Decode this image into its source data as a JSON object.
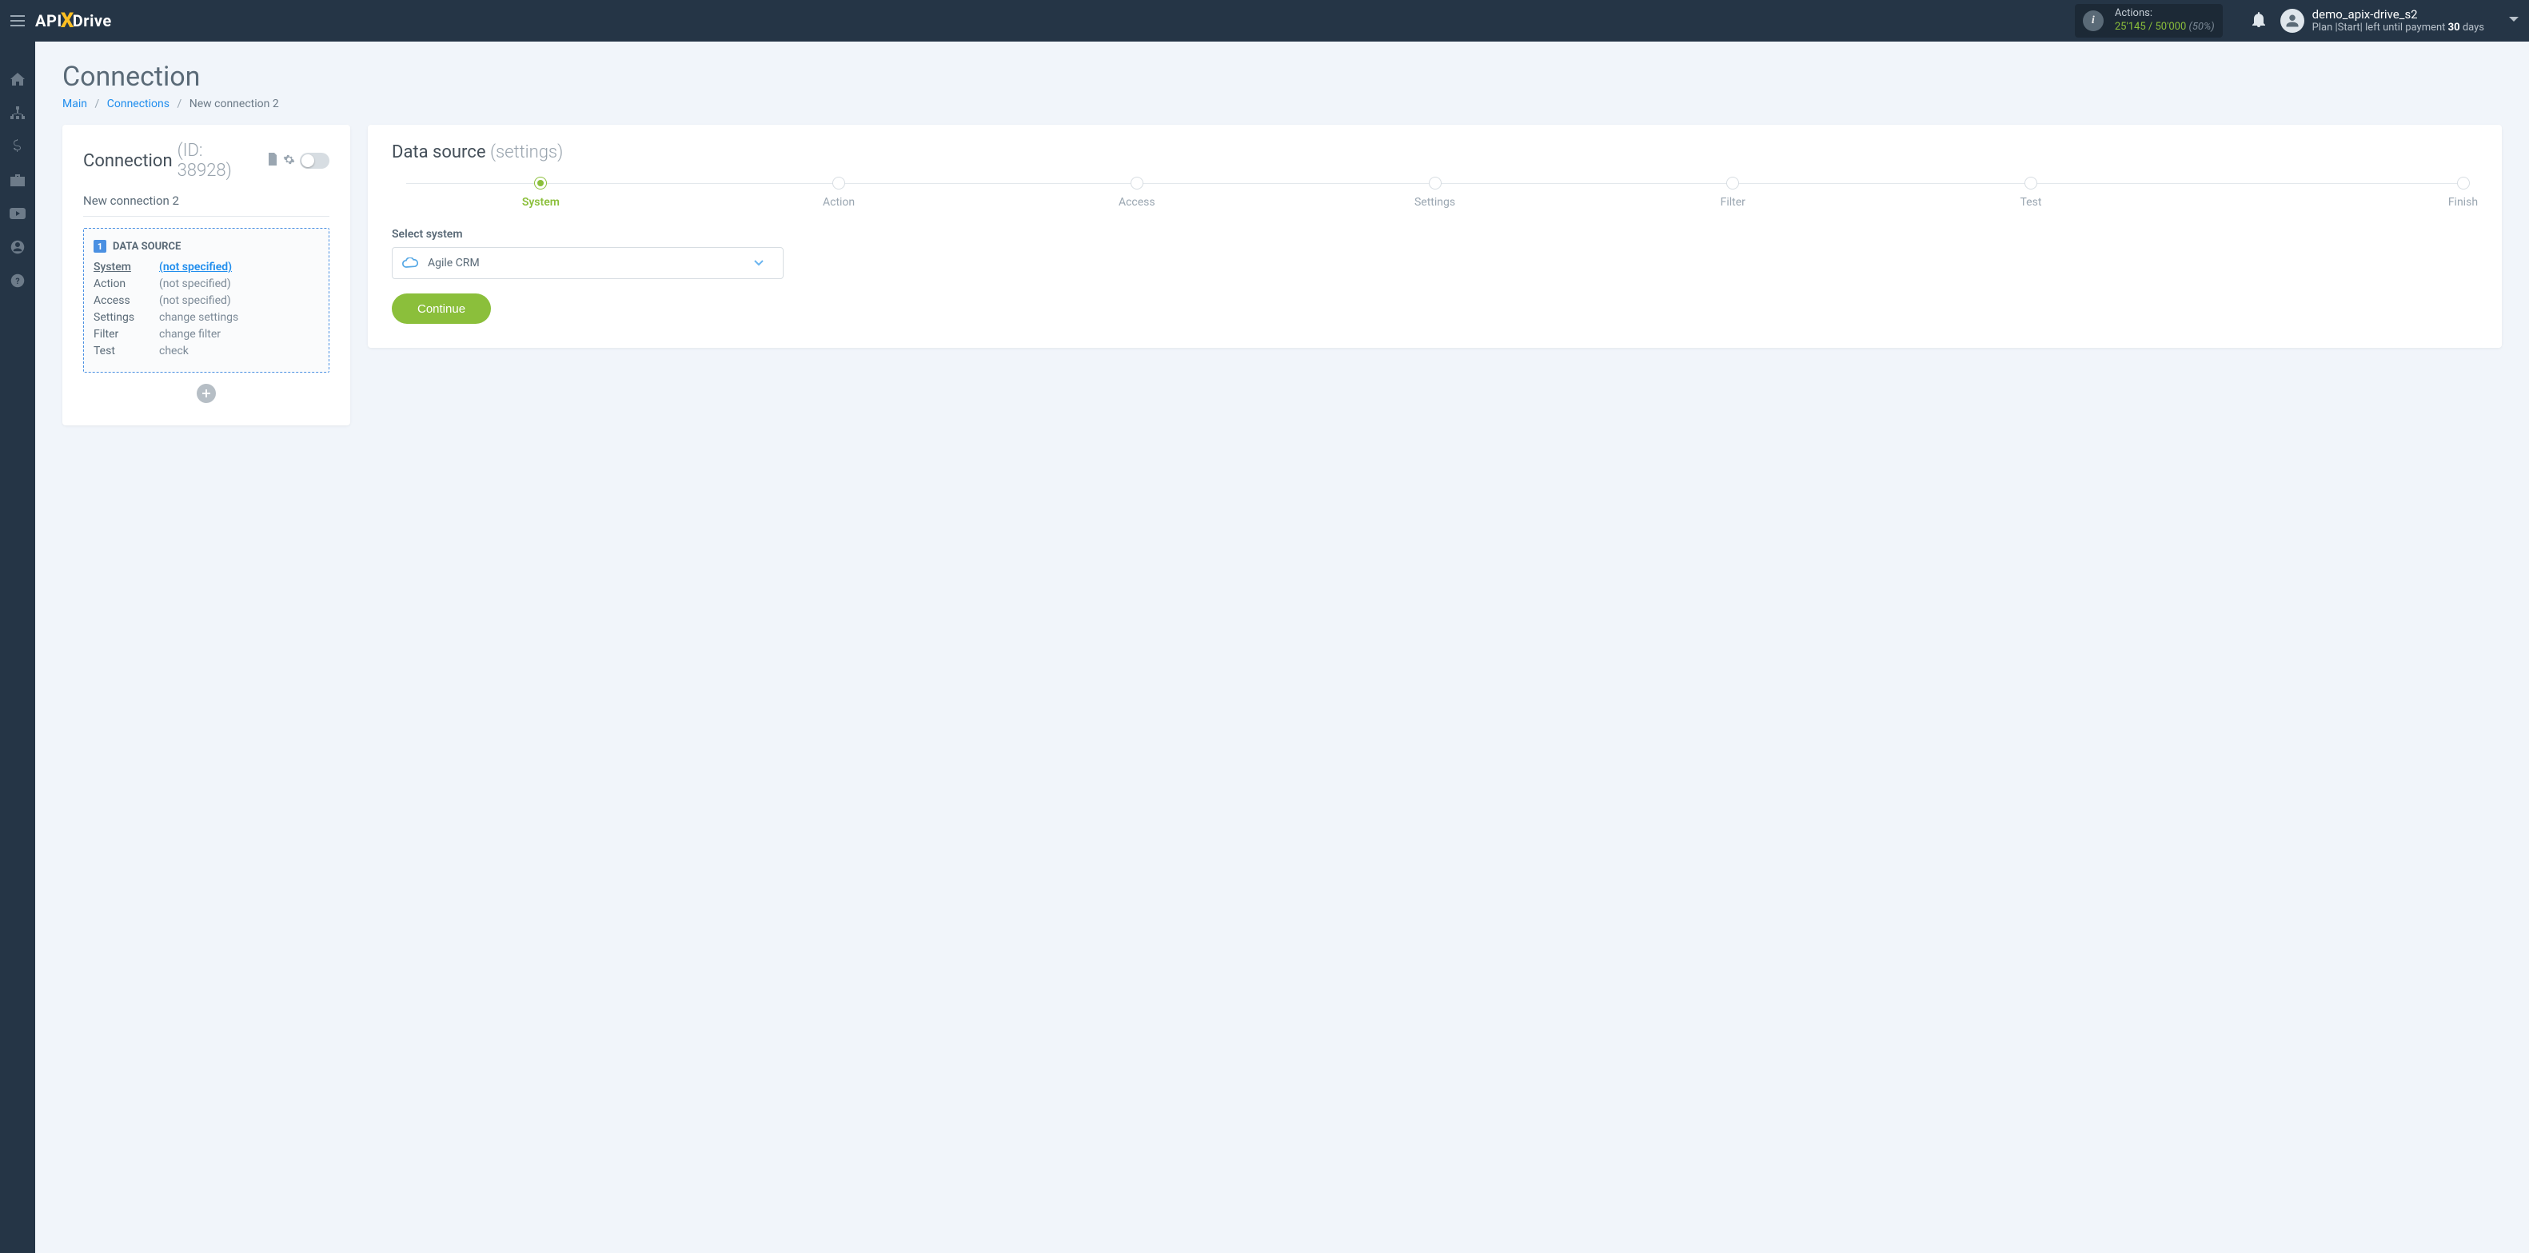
{
  "brand": {
    "api": "API",
    "x": "X",
    "drive": "Drive"
  },
  "header": {
    "actions_label": "Actions:",
    "actions_used": "25'145",
    "actions_total": "/ 50'000",
    "actions_pct": "(50%)",
    "user_name": "demo_apix-drive_s2",
    "plan_prefix": "Plan |Start| left until payment ",
    "plan_days": "30",
    "plan_suffix": " days"
  },
  "page": {
    "title": "Connection"
  },
  "breadcrumbs": {
    "main": "Main",
    "connections": "Connections",
    "current": "New connection 2"
  },
  "conn_card": {
    "title": "Connection",
    "id_text": "(ID: 38928)",
    "name": "New connection 2",
    "ds_badge": "1",
    "ds_title": "DATA SOURCE",
    "rows": {
      "system_label": "System",
      "system_val": "(not specified)",
      "action_label": "Action",
      "action_val": "(not specified)",
      "access_label": "Access",
      "access_val": "(not specified)",
      "settings_label": "Settings",
      "settings_val": "change settings",
      "filter_label": "Filter",
      "filter_val": "change filter",
      "test_label": "Test",
      "test_val": "check"
    }
  },
  "right": {
    "title": "Data source",
    "title_muted": "(settings)",
    "steps": [
      "System",
      "Action",
      "Access",
      "Settings",
      "Filter",
      "Test",
      "Finish"
    ],
    "form_label": "Select system",
    "selected_system": "Agile CRM",
    "continue": "Continue"
  }
}
